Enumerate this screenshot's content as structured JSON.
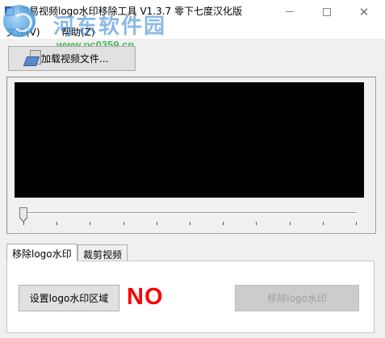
{
  "window": {
    "title": "简易视频logo水印移除工具 V1.3.7 零下七度汉化版",
    "minimize_symbol": "",
    "maximize_symbol": "",
    "close_symbol": "✕"
  },
  "watermark": {
    "site_name": "河东软件园",
    "url": "www.pc0359.cn"
  },
  "menu": {
    "file": "文件(V)",
    "help": "帮助(Z)"
  },
  "toolbar": {
    "load_video_label": "加载视频文件..."
  },
  "player": {
    "position": 0
  },
  "tabs": {
    "remove_logo": "移除logo水印",
    "crop_video": "裁剪视频"
  },
  "panel": {
    "set_region_label": "设置logo水印区域",
    "status_text": "NO",
    "remove_button_label": "移除logo水印",
    "remove_button_enabled": false
  },
  "colors": {
    "status_text": "#ff0000",
    "video_background": "#000000"
  }
}
